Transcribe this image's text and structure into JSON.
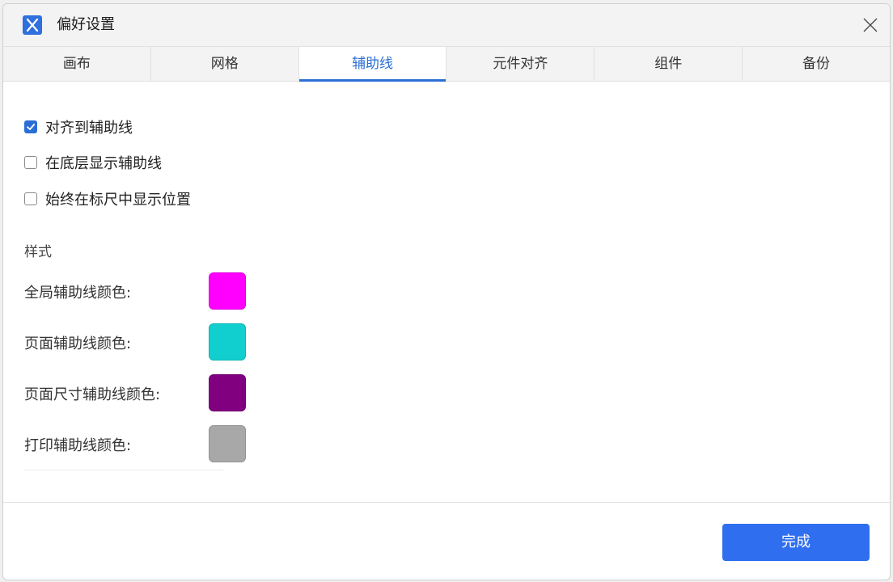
{
  "window": {
    "title": "偏好设置",
    "app_icon": "app-logo-x-icon",
    "close_icon": "close-icon"
  },
  "tabs": [
    {
      "label": "画布",
      "active": false
    },
    {
      "label": "网格",
      "active": false
    },
    {
      "label": "辅助线",
      "active": true
    },
    {
      "label": "元件对齐",
      "active": false
    },
    {
      "label": "组件",
      "active": false
    },
    {
      "label": "备份",
      "active": false
    }
  ],
  "options": [
    {
      "label": "对齐到辅助线",
      "checked": true
    },
    {
      "label": "在底层显示辅助线",
      "checked": false
    },
    {
      "label": "始终在标尺中显示位置",
      "checked": false
    }
  ],
  "style": {
    "heading": "样式",
    "colors": [
      {
        "label": "全局辅助线颜色:",
        "color": "#ff00ff"
      },
      {
        "label": "页面辅助线颜色:",
        "color": "#12cfcf"
      },
      {
        "label": "页面尺寸辅助线颜色:",
        "color": "#800080"
      },
      {
        "label": "打印辅助线颜色:",
        "color": "#a8a8a8"
      }
    ]
  },
  "footer": {
    "done_label": "完成"
  },
  "theme": {
    "accent": "#2b6fd6",
    "button": "#2f6fef"
  }
}
